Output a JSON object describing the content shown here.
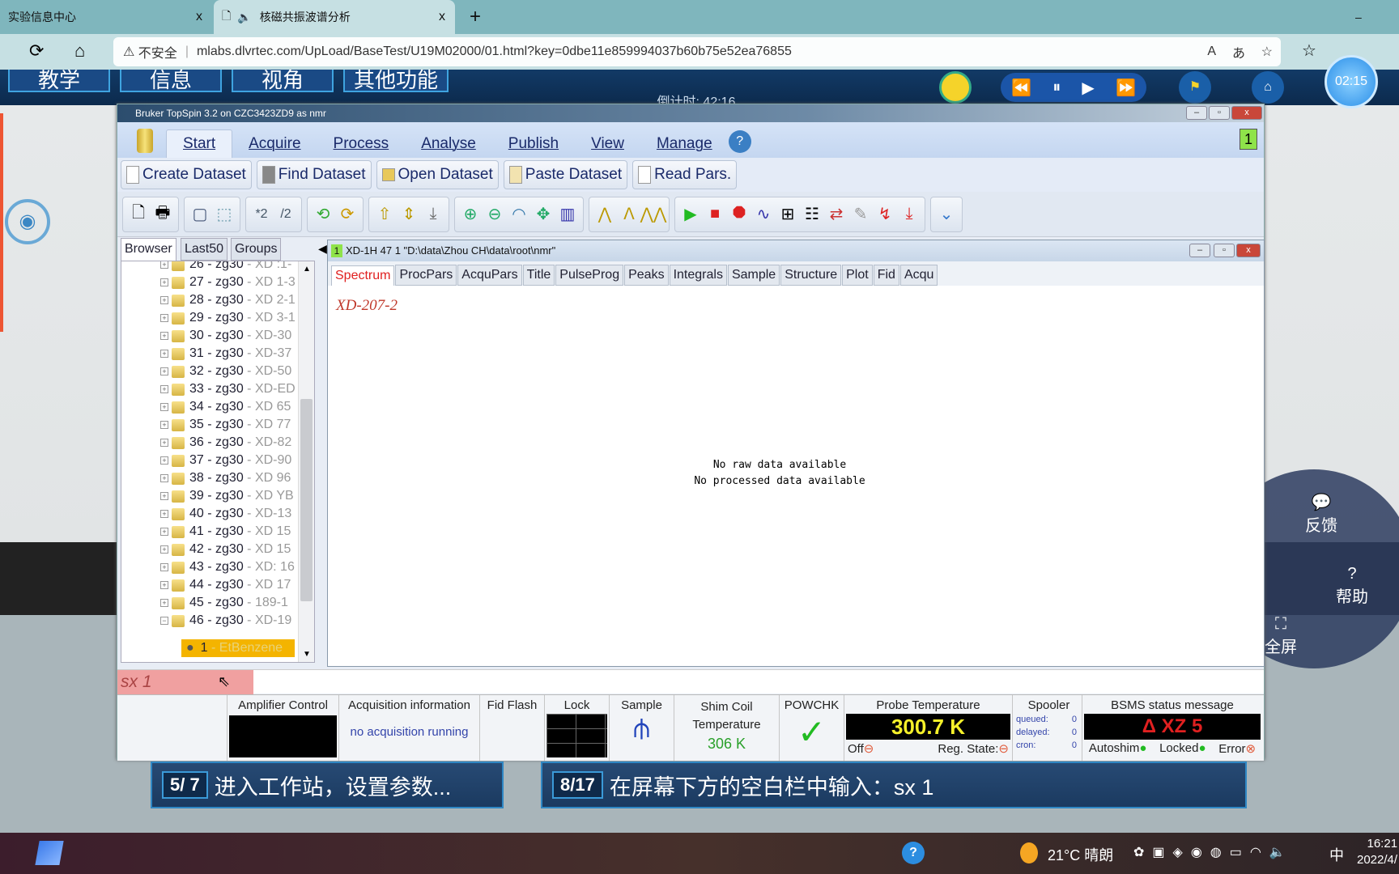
{
  "browser": {
    "tabs": [
      {
        "label": "实验信息中心",
        "close": "x"
      },
      {
        "label": "核磁共振波谱分析",
        "close": "x"
      }
    ],
    "new_tab": "+",
    "minimize": "–",
    "security": "不安全",
    "url": "mlabs.dlvrtec.com/UpLoad/BaseTest/U19M02000/01.html?key=0dbe11e859994037b60b75e52ea76855"
  },
  "game": {
    "nav": [
      "教学",
      "信息",
      "视角",
      "其他功能"
    ],
    "countdown": "倒计时: 42:16",
    "timer": "02:15",
    "radial": {
      "feedback": "反馈",
      "help": "帮助",
      "fullscreen": "全屏"
    }
  },
  "topspin": {
    "title": "Bruker TopSpin 3.2 on CZC3423ZD9 as nmr",
    "menu": [
      "Start",
      "Acquire",
      "Process",
      "Analyse",
      "Publish",
      "View",
      "Manage"
    ],
    "window_count": "1",
    "dataset_buttons": [
      "Create Dataset",
      "Find Dataset",
      "Open Dataset",
      "Paste Dataset",
      "Read Pars."
    ],
    "toolbar_labels": {
      "scale_up": "*2",
      "scale_down": "/2"
    },
    "browser_tabs": [
      "Browser",
      "Last50",
      "Groups"
    ],
    "tree": [
      {
        "num": "26",
        "pp": "zg30",
        "name": "XD :1-"
      },
      {
        "num": "27",
        "pp": "zg30",
        "name": "XD 1-3"
      },
      {
        "num": "28",
        "pp": "zg30",
        "name": "XD 2-1"
      },
      {
        "num": "29",
        "pp": "zg30",
        "name": "XD 3-1"
      },
      {
        "num": "30",
        "pp": "zg30",
        "name": "XD-30"
      },
      {
        "num": "31",
        "pp": "zg30",
        "name": "XD-37"
      },
      {
        "num": "32",
        "pp": "zg30",
        "name": "XD-50"
      },
      {
        "num": "33",
        "pp": "zg30",
        "name": "XD-ED"
      },
      {
        "num": "34",
        "pp": "zg30",
        "name": "XD 65"
      },
      {
        "num": "35",
        "pp": "zg30",
        "name": "XD 77"
      },
      {
        "num": "36",
        "pp": "zg30",
        "name": "XD-82"
      },
      {
        "num": "37",
        "pp": "zg30",
        "name": "XD-90"
      },
      {
        "num": "38",
        "pp": "zg30",
        "name": "XD 96"
      },
      {
        "num": "39",
        "pp": "zg30",
        "name": "XD YB"
      },
      {
        "num": "40",
        "pp": "zg30",
        "name": "XD-13"
      },
      {
        "num": "41",
        "pp": "zg30",
        "name": "XD 15"
      },
      {
        "num": "42",
        "pp": "zg30",
        "name": "XD 15"
      },
      {
        "num": "43",
        "pp": "zg30",
        "name": "XD: 16"
      },
      {
        "num": "44",
        "pp": "zg30",
        "name": "XD 17"
      },
      {
        "num": "45",
        "pp": "zg30",
        "name": "189-1"
      },
      {
        "num": "46",
        "pp": "zg30",
        "name": "XD-19"
      }
    ],
    "tree_selected": {
      "num": "1",
      "name": "EtBenzene"
    },
    "data_window": {
      "num": "1",
      "title": "XD-1H 47 1  \"D:\\data\\Zhou CH\\data\\root\\nmr\"",
      "tabs": [
        "Spectrum",
        "ProcPars",
        "AcquPars",
        "Title",
        "PulseProg",
        "Peaks",
        "Integrals",
        "Sample",
        "Structure",
        "Plot",
        "Fid",
        "Acqu"
      ],
      "dataset_name": "XD-207-2",
      "msg1": "No raw data available",
      "msg2": "No processed data available"
    },
    "command": "sx 1",
    "status": {
      "amp": "Amplifier Control",
      "acq": "Acquisition information",
      "acq_value": "no acquisition running",
      "fid": "Fid Flash",
      "lock": "Lock",
      "sample": "Sample",
      "shim": "Shim Coil Temperature",
      "shim_value": "306 K",
      "powchk": "POWCHK",
      "probe": "Probe Temperature",
      "probe_value": "300.7 K",
      "off": "Off",
      "reg": "Reg. State:",
      "spooler": "Spooler",
      "queued": "queued:",
      "queued_v": "0",
      "delayed": "delayed:",
      "delayed_v": "0",
      "cron": "cron:",
      "cron_v": "0",
      "bsms": "BSMS status message",
      "bsms_value": "Δ XZ  5",
      "autoshim": "Autoshim",
      "locked": "Locked",
      "error": "Error"
    }
  },
  "hints": [
    {
      "step": "5/ 7",
      "text": "进入工作站，设置参数..."
    },
    {
      "step": "8/17",
      "text": "在屏幕下方的空白栏中输入：sx 1"
    }
  ],
  "taskbar": {
    "weather": "21°C  晴朗",
    "ime": "中",
    "time": "16:21",
    "date": "2022/4/"
  },
  "colors": {
    "accent": "#1a2a6a",
    "active_tab": "#e02020",
    "probe_value": "#f5f02a",
    "bsms_value": "#e02020",
    "shim_value": "#2aa02a"
  }
}
